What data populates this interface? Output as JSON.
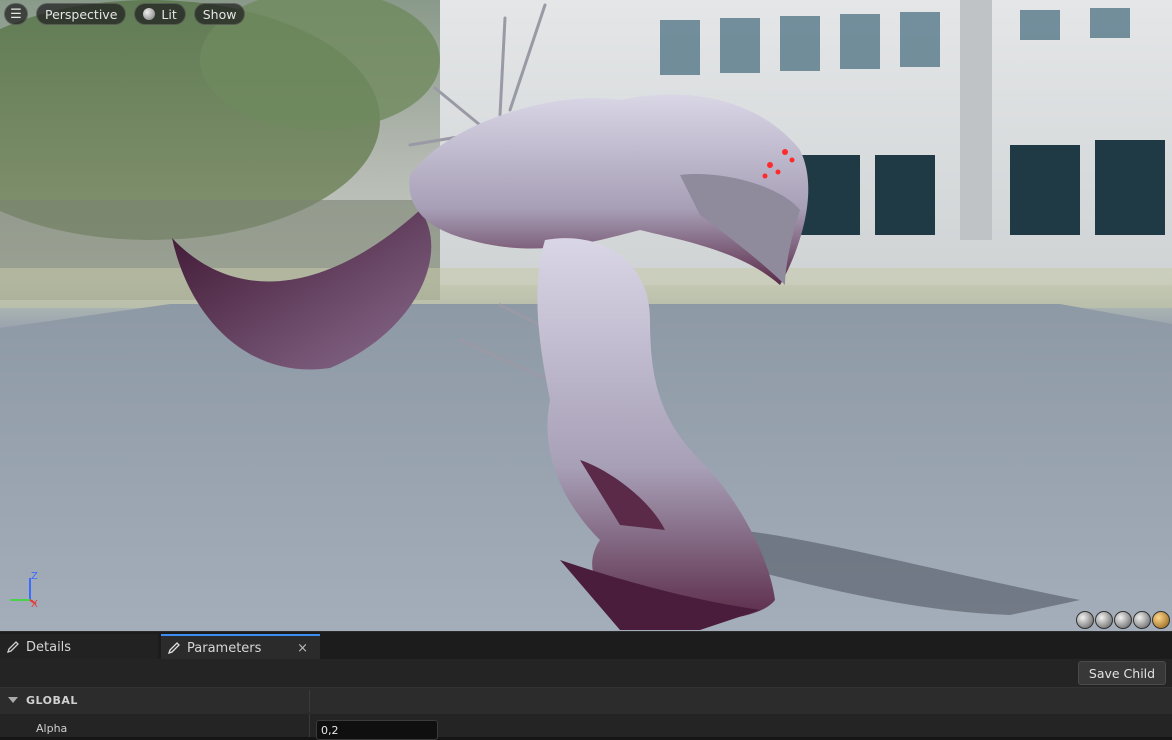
{
  "viewport": {
    "menu_icon": "hamburger-icon",
    "perspective_label": "Perspective",
    "lit_label": "Lit",
    "show_label": "Show",
    "axis_z": "Z",
    "axis_x": "X"
  },
  "tabs": {
    "details_label": "Details",
    "parameters_label": "Parameters",
    "close_glyph": "×"
  },
  "toolbar": {
    "save_child_label": "Save Child"
  },
  "section": {
    "title": "GLOBAL"
  },
  "params": [
    {
      "label": "Alpha",
      "value": "0,2"
    }
  ],
  "colors": {
    "accent": "#3b8ef0",
    "panel": "#242424",
    "creature": "#c9c6d8",
    "creature_dark": "#5a2a48"
  }
}
